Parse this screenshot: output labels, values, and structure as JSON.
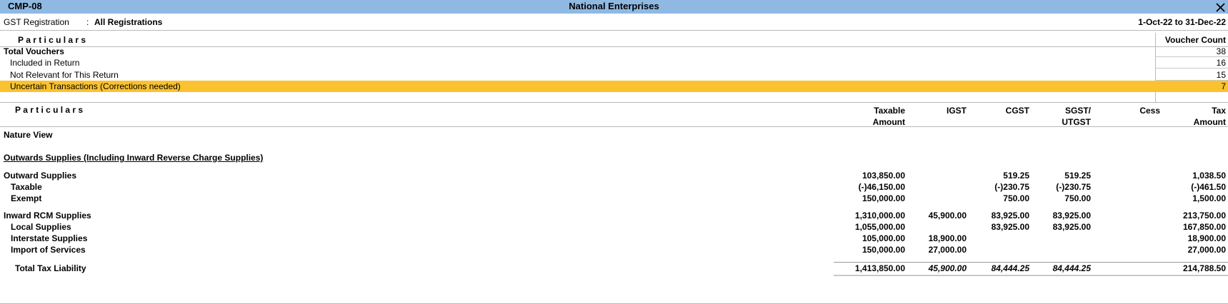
{
  "titlebar": {
    "report_code": "CMP-08",
    "company": "National Enterprises"
  },
  "header": {
    "gst_label": "GST Registration",
    "colon": ":",
    "gst_value": "All Registrations",
    "period": "1-Oct-22 to 31-Dec-22"
  },
  "summary": {
    "col_particulars": "Particulars",
    "col_count": "Voucher Count",
    "rows": [
      {
        "label": "Total Vouchers",
        "count": "38"
      },
      {
        "label": "Included in Return",
        "count": "16"
      },
      {
        "label": "Not Relevant for This Return",
        "count": "15"
      },
      {
        "label": "Uncertain Transactions (Corrections needed)",
        "count": "7"
      }
    ],
    "highlight_color": "#fbc22f"
  },
  "details": {
    "col_particulars": "Particulars",
    "col_taxable_1": "Taxable",
    "col_taxable_2": "Amount",
    "col_igst": "IGST",
    "col_cgst": "CGST",
    "col_sgst_1": "SGST/",
    "col_sgst_2": "UTGST",
    "col_cess": "Cess",
    "col_tax_1": "Tax",
    "col_tax_2": "Amount",
    "nature_view": "Nature View",
    "section_title": "Outwards Supplies (Including Inward Reverse Charge Supplies)",
    "outward": {
      "label": "Outward Supplies",
      "taxable": "103,850.00",
      "cgst": "519.25",
      "sgst": "519.25",
      "tax": "1,038.50"
    },
    "taxable": {
      "label": "Taxable",
      "taxable": "(-)46,150.00",
      "cgst": "(-)230.75",
      "sgst": "(-)230.75",
      "tax": "(-)461.50"
    },
    "exempt": {
      "label": "Exempt",
      "taxable": "150,000.00",
      "cgst": "750.00",
      "sgst": "750.00",
      "tax": "1,500.00"
    },
    "inward_rcm": {
      "label": "Inward RCM Supplies",
      "taxable": "1,310,000.00",
      "igst": "45,900.00",
      "cgst": "83,925.00",
      "sgst": "83,925.00",
      "tax": "213,750.00"
    },
    "local": {
      "label": "Local Supplies",
      "taxable": "1,055,000.00",
      "cgst": "83,925.00",
      "sgst": "83,925.00",
      "tax": "167,850.00"
    },
    "interstate": {
      "label": "Interstate Supplies",
      "taxable": "105,000.00",
      "igst": "18,900.00",
      "tax": "18,900.00"
    },
    "import": {
      "label": "Import of Services",
      "taxable": "150,000.00",
      "igst": "27,000.00",
      "tax": "27,000.00"
    },
    "total": {
      "label": "Total Tax Liability",
      "taxable": "1,413,850.00",
      "igst": "45,900.00",
      "cgst": "84,444.25",
      "sgst": "84,444.25",
      "tax": "214,788.50"
    }
  },
  "colors": {
    "titlebar": "#8fb9e3",
    "highlight": "#fbc22f"
  }
}
